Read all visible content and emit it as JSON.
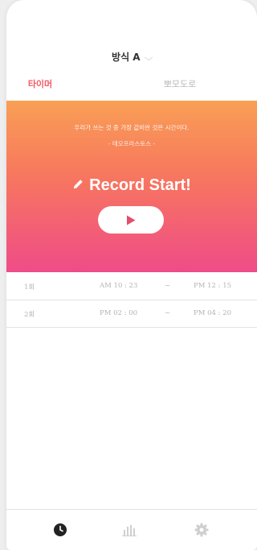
{
  "header": {
    "mode_label": "방식 A",
    "mode_chevron": "⌵"
  },
  "tabs": [
    {
      "label": "타이머",
      "active": true
    },
    {
      "label": "뽀모도로",
      "active": false
    }
  ],
  "hero": {
    "quote": "우리가 쓰는 것 중 가장 값비싼 것은 시간이다.",
    "author": "- 테오프라스토스 -",
    "record_label": "Record Start!",
    "gradient": [
      "#f99f55",
      "#f7765f",
      "#ef4c88"
    ]
  },
  "records": [
    {
      "index": "1회",
      "start": "AM 10 : 23",
      "separator": "~",
      "end": "PM 12 : 15"
    },
    {
      "index": "2회",
      "start": "PM 02 : 00",
      "separator": "~",
      "end": "PM 04 : 20"
    }
  ],
  "bottom_nav": [
    {
      "icon": "clock-icon",
      "active": true
    },
    {
      "icon": "bar-chart-icon",
      "active": false
    },
    {
      "icon": "gear-icon",
      "active": false
    }
  ],
  "colors": {
    "accent": "#f25b66",
    "muted": "#b8b8b8"
  }
}
